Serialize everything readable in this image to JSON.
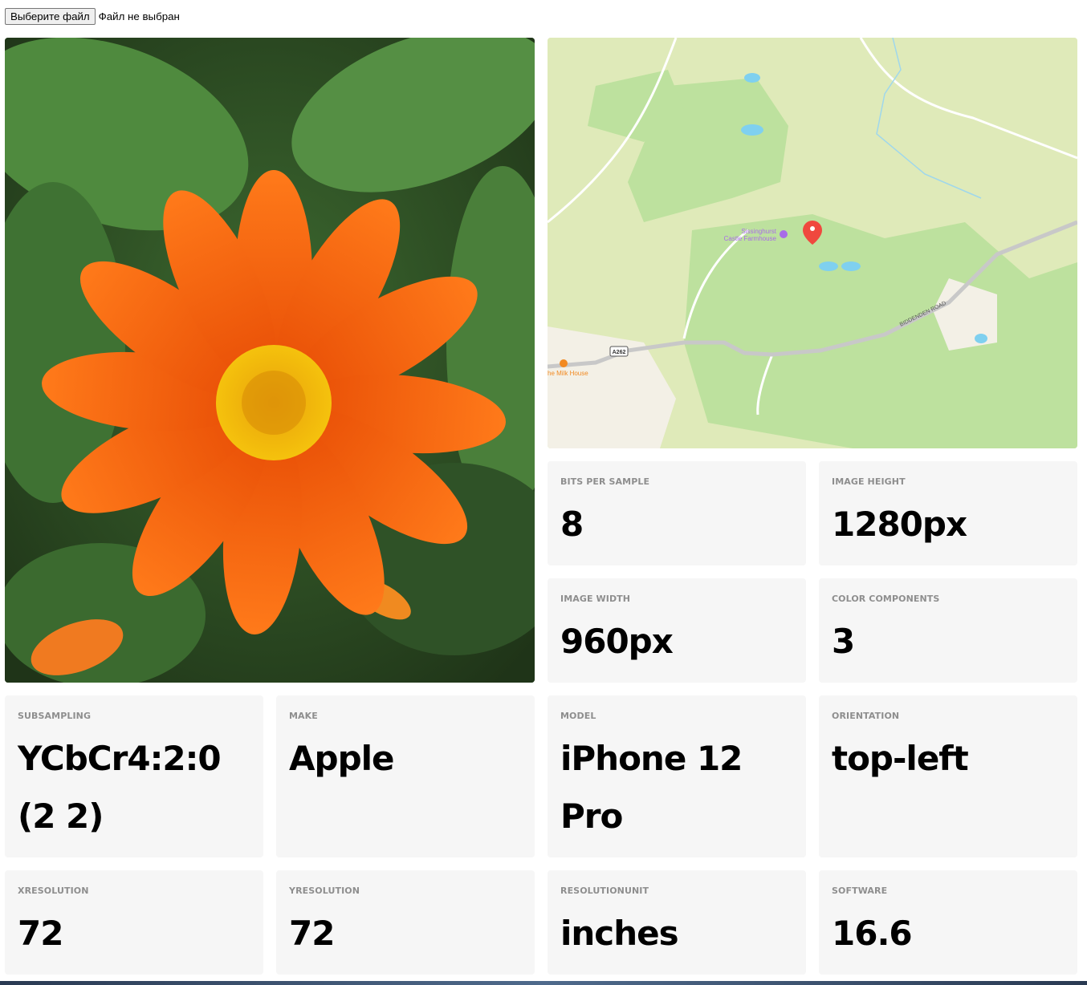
{
  "file_input": {
    "button_label": "Выберите файл",
    "status": "Файл не выбран"
  },
  "photo": {
    "subject": "orange flower (Mexican sunflower) with green leaves",
    "icon": "photo-image"
  },
  "map": {
    "poi_label_line1": "Sissinghurst",
    "poi_label_line2": "Castle Farmhouse",
    "road_shield": "A262",
    "road_name": "BIDDENDEN ROAD",
    "restaurant_label": "he Milk House",
    "colors": {
      "land": "#dfeab9",
      "forest": "#bde19e",
      "water": "#7fd0ef",
      "road": "#c8c8c8",
      "pin": "#f0483e",
      "poi": "#a86ce8",
      "restaurant": "#f28a22"
    }
  },
  "exif": [
    {
      "label": "BITS PER SAMPLE",
      "value": "8"
    },
    {
      "label": "IMAGE HEIGHT",
      "value": "1280px"
    },
    {
      "label": "IMAGE WIDTH",
      "value": "960px"
    },
    {
      "label": "COLOR COMPONENTS",
      "value": "3"
    },
    {
      "label": "SUBSAMPLING",
      "value": "YCbCr4:2:0 (2 2)"
    },
    {
      "label": "MAKE",
      "value": "Apple"
    },
    {
      "label": "MODEL",
      "value": "iPhone 12 Pro"
    },
    {
      "label": "ORIENTATION",
      "value": "top-left"
    },
    {
      "label": "XRESOLUTION",
      "value": "72"
    },
    {
      "label": "YRESOLUTION",
      "value": "72"
    },
    {
      "label": "RESOLUTIONUNIT",
      "value": "inches"
    },
    {
      "label": "SOFTWARE",
      "value": "16.6"
    }
  ]
}
